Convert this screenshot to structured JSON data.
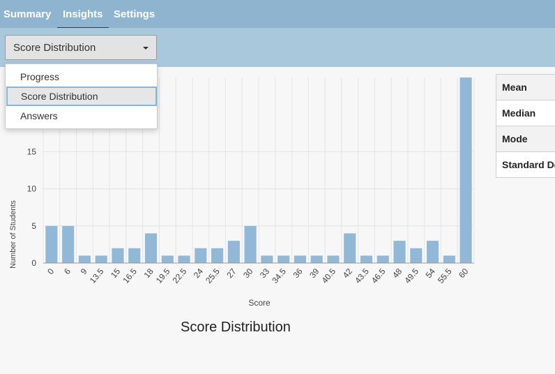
{
  "nav": {
    "tabs": [
      {
        "label": "Summary",
        "active": false
      },
      {
        "label": "Insights",
        "active": true
      },
      {
        "label": "Settings",
        "active": false
      }
    ]
  },
  "view_select": {
    "selected": "Score Distribution",
    "options": [
      "Progress",
      "Score Distribution",
      "Answers"
    ]
  },
  "stats": {
    "labels": [
      "Mean",
      "Median",
      "Mode",
      "Standard De"
    ]
  },
  "colors": {
    "bar": "#91b8d7",
    "nav": "#8fb4d0",
    "subbar": "#a9c8dc"
  },
  "chart_data": {
    "type": "bar",
    "title": "Score Distribution",
    "xlabel": "Score",
    "ylabel": "Number of Students",
    "categories": [
      "0",
      "6",
      "9",
      "13.5",
      "15",
      "16.5",
      "18",
      "19.5",
      "22.5",
      "24",
      "25.5",
      "27",
      "30",
      "33",
      "34.5",
      "36",
      "39",
      "40.5",
      "42",
      "43.5",
      "46.5",
      "48",
      "49.5",
      "54",
      "55.5",
      "60"
    ],
    "values": [
      5,
      5,
      1,
      1,
      2,
      2,
      4,
      1,
      1,
      2,
      2,
      3,
      5,
      1,
      1,
      1,
      1,
      1,
      4,
      1,
      1,
      3,
      2,
      3,
      1,
      25
    ],
    "yticks": [
      0,
      5,
      10,
      15
    ],
    "ylim": [
      0,
      25
    ],
    "grid": true
  }
}
